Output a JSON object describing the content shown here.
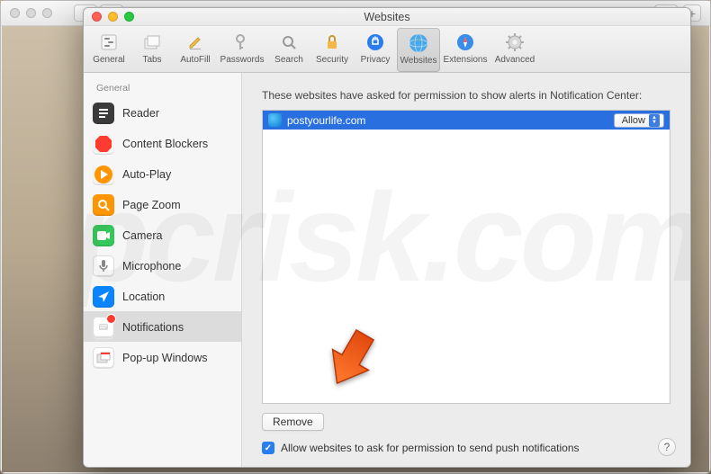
{
  "window_title": "Websites",
  "toolbar": [
    {
      "label": "General",
      "icon": "switches"
    },
    {
      "label": "Tabs",
      "icon": "tabs"
    },
    {
      "label": "AutoFill",
      "icon": "pencil"
    },
    {
      "label": "Passwords",
      "icon": "key"
    },
    {
      "label": "Search",
      "icon": "magnifier"
    },
    {
      "label": "Security",
      "icon": "lock"
    },
    {
      "label": "Privacy",
      "icon": "hand"
    },
    {
      "label": "Websites",
      "icon": "globe",
      "selected": true
    },
    {
      "label": "Extensions",
      "icon": "puzzle"
    },
    {
      "label": "Advanced",
      "icon": "gear"
    }
  ],
  "sidebar": {
    "group_label": "General",
    "items": [
      {
        "label": "Reader",
        "color": "#3a3a3a",
        "icon": "reader"
      },
      {
        "label": "Content Blockers",
        "color": "#ff3b30",
        "icon": "stop"
      },
      {
        "label": "Auto-Play",
        "color": "#ff9500",
        "icon": "play"
      },
      {
        "label": "Page Zoom",
        "color": "#ff9500",
        "icon": "zoom"
      },
      {
        "label": "Camera",
        "color": "#34c759",
        "icon": "camera"
      },
      {
        "label": "Microphone",
        "color": "#ffffff",
        "icon": "mic"
      },
      {
        "label": "Location",
        "color": "#0a84ff",
        "icon": "arrow"
      },
      {
        "label": "Notifications",
        "color": "#ffffff",
        "icon": "bell",
        "selected": true,
        "badge": true
      },
      {
        "label": "Pop-up Windows",
        "color": "#ffffff",
        "icon": "popup"
      }
    ]
  },
  "content": {
    "header": "These websites have asked for permission to show alerts in Notification Center:",
    "sites": [
      {
        "domain": "postyourlife.com",
        "permission": "Allow"
      }
    ],
    "remove_label": "Remove",
    "checkbox_label": "Allow websites to ask for permission to send push notifications",
    "checkbox_checked": true
  },
  "help_label": "?"
}
